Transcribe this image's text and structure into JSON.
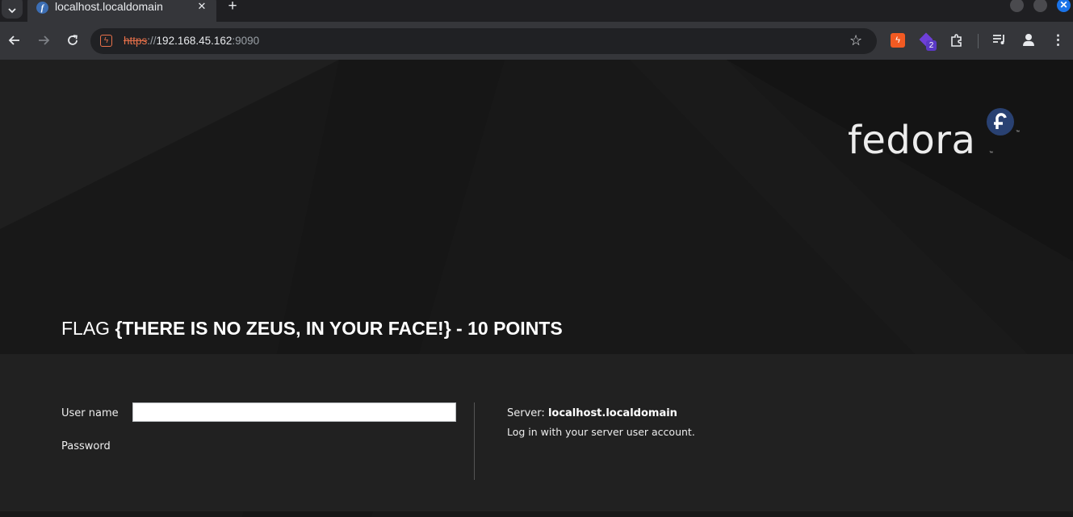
{
  "browser": {
    "tab_title": "localhost.localdomain",
    "close_glyph": "✕",
    "new_tab_glyph": "+",
    "url": {
      "scheme": "https",
      "separator": "://",
      "host": "192.168.45.162",
      "port": ":9090"
    },
    "extension_badge": "2",
    "icons": [
      "tab-search-icon",
      "fedora-favicon-icon",
      "back-icon",
      "forward-icon",
      "reload-icon",
      "not-secure-icon",
      "star-icon",
      "extension-icon",
      "puzzle-icon",
      "media-icon",
      "profile-icon",
      "menu-icon"
    ],
    "colors": {
      "chrome_bg": "#35363a",
      "omnibox_bg": "#202124",
      "not_secure": "#e8714a",
      "accent": "#1a73e8"
    }
  },
  "branding": {
    "logo_text": "fedora",
    "trademark": "™"
  },
  "flag": {
    "prefix": "FLAG",
    "text": "{THERE IS NO ZEUS, IN YOUR FACE!} - 10 POINTS"
  },
  "login": {
    "username_label": "User name",
    "username_value": "",
    "password_label": "Password",
    "server_prefix": "Server:",
    "server_name": "localhost.localdomain",
    "hint": "Log in with your server user account."
  },
  "colors": {
    "page_bg": "#181818",
    "panel_bg": "#212121",
    "fedora_blue": "#294172"
  }
}
